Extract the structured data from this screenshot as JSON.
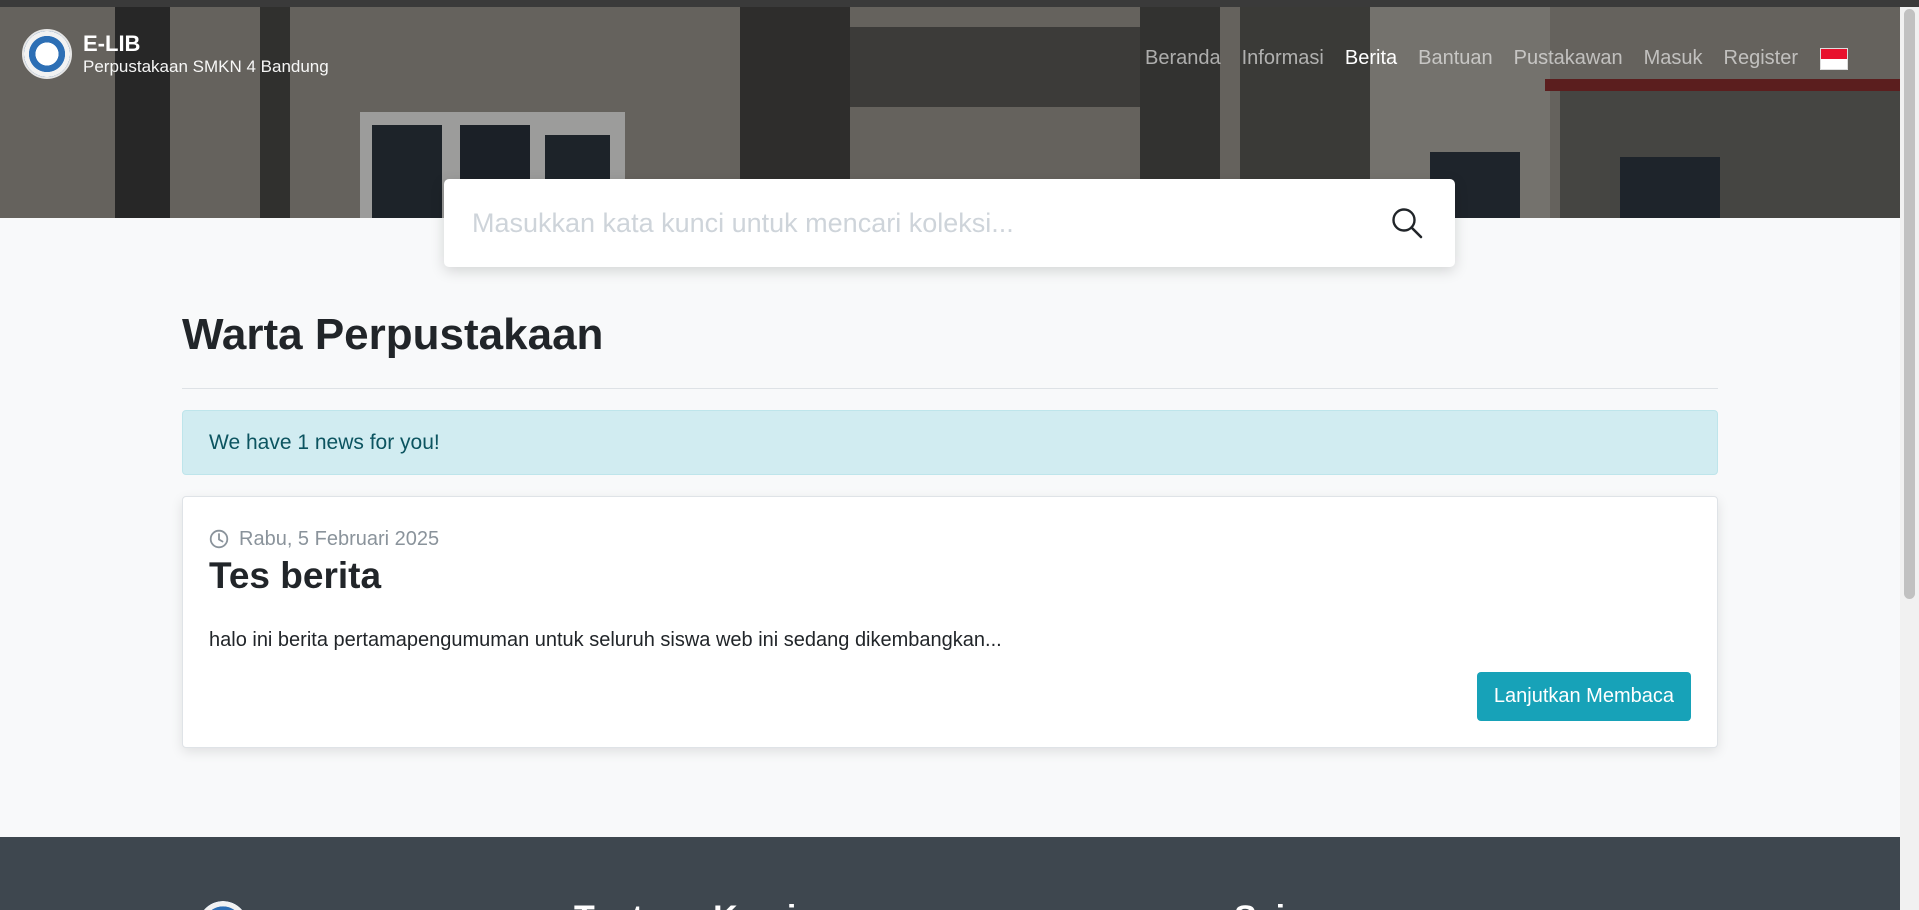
{
  "brand": {
    "title": "E-LIB",
    "subtitle": "Perpustakaan SMKN 4 Bandung",
    "logo_icon": "school-emblem-logo"
  },
  "nav": {
    "items": [
      {
        "label": "Beranda",
        "active": false
      },
      {
        "label": "Informasi",
        "active": false
      },
      {
        "label": "Berita",
        "active": true
      },
      {
        "label": "Bantuan",
        "active": false
      },
      {
        "label": "Pustakawan",
        "active": false
      },
      {
        "label": "Masuk",
        "active": false
      },
      {
        "label": "Register",
        "active": false
      }
    ],
    "language_icon": "indonesia-flag-icon"
  },
  "search": {
    "placeholder": "Masukkan kata kunci untuk mencari koleksi...",
    "icon": "search-icon"
  },
  "main": {
    "title": "Warta Perpustakaan",
    "alert": "We have 1 news for you!",
    "news": [
      {
        "date": "Rabu, 5 Februari 2025",
        "title": "Tes berita",
        "excerpt": "halo ini berita pertamapengumuman untuk seluruh siswa web ini sedang dikembangkan...",
        "button": "Lanjutkan Membaca"
      }
    ]
  },
  "footer": {
    "headings": [
      "Tentang Kami",
      "Sci..."
    ]
  },
  "colors": {
    "accent": "#17a2b8",
    "alert_bg": "#d1ecf1",
    "alert_text": "#0c5460",
    "footer_bg": "#3e474f",
    "page_bg": "#f8f9fa"
  }
}
